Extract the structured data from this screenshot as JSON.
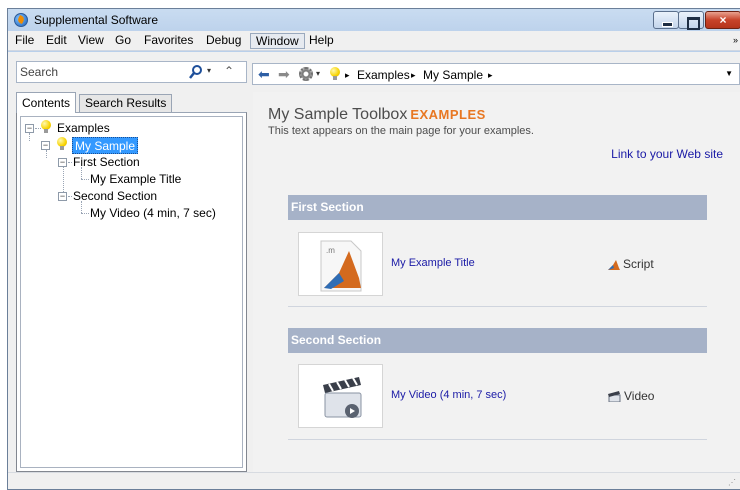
{
  "window": {
    "title": "Supplemental Software",
    "close_glyph": "×"
  },
  "menu": [
    "File",
    "Edit",
    "View",
    "Go",
    "Favorites",
    "Debug",
    "Window",
    "Help"
  ],
  "menu_overflow": "»",
  "search": {
    "placeholder": "Search",
    "search_icon": "magnifier-icon",
    "dropdown_glyph": "▾",
    "collapse_glyph": "⌃"
  },
  "tabs": [
    "Contents",
    "Search Results"
  ],
  "tree": {
    "root": "Examples",
    "child": "My Sample",
    "sections": [
      "First Section",
      "Second Section"
    ],
    "items": [
      "My Example Title",
      "My Video (4 min, 7 sec)"
    ],
    "expander_glyph": "−"
  },
  "address_bar": {
    "back_glyph": "⬅",
    "forward_glyph": "➡",
    "sep": "▸",
    "crumbs": [
      "Examples",
      "My Sample"
    ],
    "dropdown_glyph": "▼"
  },
  "page": {
    "title": "My Sample Toolbox",
    "title_tag": "EXAMPLES",
    "description": "This text appears on the main page for your examples.",
    "web_link": "Link to your Web site",
    "sections": [
      {
        "heading": "First Section",
        "item": "My Example Title",
        "type": "Script"
      },
      {
        "heading": "Second Section",
        "item": "My Video (4 min, 7 sec)",
        "type": "Video"
      }
    ]
  },
  "colors": {
    "section_header": "#a6b2c8",
    "link": "#1a1aa6",
    "accent": "#e87722",
    "selection": "#3399ff"
  }
}
